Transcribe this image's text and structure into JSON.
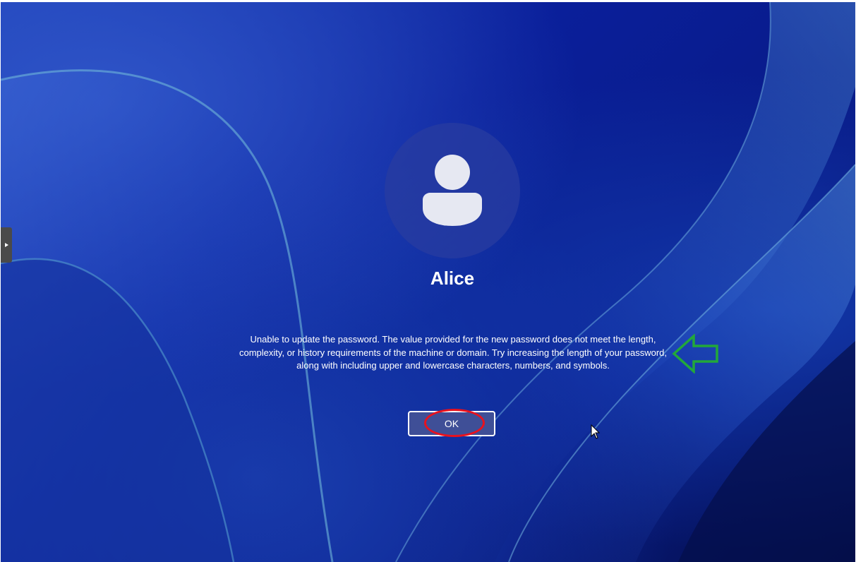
{
  "user": {
    "name": "Alice",
    "avatar_icon": "person-icon"
  },
  "dialog": {
    "message": "Unable to update the password. The value provided for the new password does not meet the length, complexity, or history requirements of the machine or domain. Try increasing the length of your password, along with including upper and lowercase characters, numbers, and symbols.",
    "ok_label": "OK"
  },
  "annotations": {
    "arrow_icon": "left-arrow-icon",
    "arrow_color": "#22a83a",
    "highlight_color": "#e8121e"
  },
  "side_tab": {
    "icon": "expand-right-icon"
  },
  "colors": {
    "background": "#0a1f9a",
    "button_fill": "#3f4f97"
  }
}
